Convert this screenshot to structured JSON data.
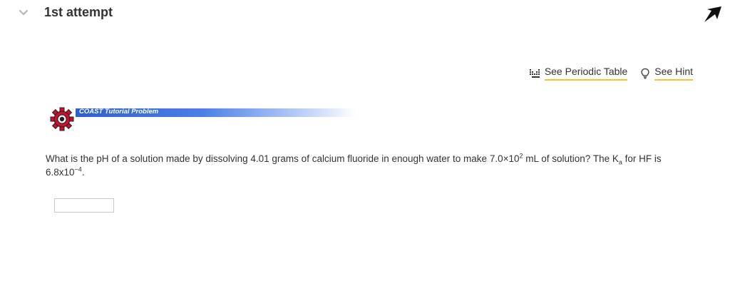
{
  "attempt": {
    "title": "1st attempt"
  },
  "tools": {
    "periodic_table_label": "See Periodic Table",
    "hint_label": "See Hint"
  },
  "banner": {
    "label": "COAST Tutorial Problem"
  },
  "question": {
    "part1": "What is the pH of a solution made by dissolving 4.01 grams of calcium fluoride in enough water to make 7.0×10",
    "exp1": "2",
    "part2": " mL of solution? The K",
    "sub1": "a",
    "part3": " for HF is 6.8x10",
    "exp2": "−4",
    "part4": "."
  },
  "answer": {
    "value": "",
    "placeholder": ""
  },
  "colors": {
    "link_underline": "#f2c335",
    "banner_blue": "#2f5fcf",
    "gear_red": "#c8102e"
  }
}
